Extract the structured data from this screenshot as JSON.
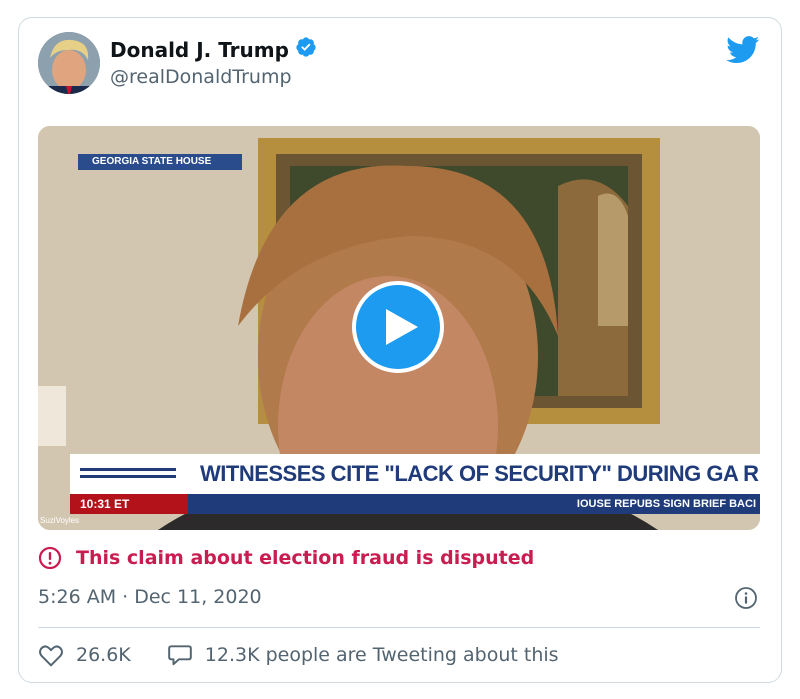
{
  "tweet": {
    "display_name": "Donald J. Trump",
    "handle": "@realDonaldTrump",
    "verified": true,
    "disputed_label": "This claim about election fraud is disputed",
    "timestamp": "5:26 AM · Dec 11, 2020",
    "likes": "26.6K",
    "retweet_text": "12.3K people are Tweeting about this",
    "icons": {
      "logo": "twitter-bird-icon",
      "verified": "verified-badge-icon",
      "play": "play-icon",
      "disputed": "exclamation-circle-icon",
      "info": "info-icon",
      "like": "heart-icon",
      "reply": "speech-bubble-icon"
    }
  },
  "video": {
    "location_tag": "GEORGIA STATE HOUSE",
    "headline": "WITNESSES CITE \"LACK OF SECURITY\" DURING GA RECOUNT",
    "time": "10:31 ET",
    "ticker": "IOUSE REPUBS SIGN BRIEF BACI",
    "watermark": "SuziVoyles"
  },
  "colors": {
    "twitter_blue": "#1d9bf0",
    "disputed_red": "#c91c50",
    "secondary_text": "#536471",
    "chyron_blue": "#1f3b7a",
    "chyron_red": "#b3121b"
  }
}
